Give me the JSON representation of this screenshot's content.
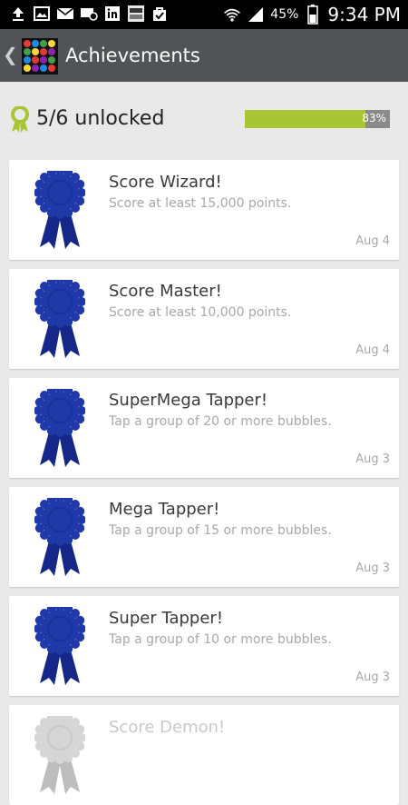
{
  "status_bar": {
    "battery": "45%",
    "time": "9:34 PM",
    "icons": [
      "upload-icon",
      "image-icon",
      "mail-icon",
      "mail-at-icon",
      "linkedin-icon",
      "basic4android-icon",
      "bag-icon"
    ]
  },
  "action_bar": {
    "title": "Achievements"
  },
  "summary": {
    "unlocked": "5/6 unlocked",
    "progress_label": "83%",
    "progress_fraction": 0.83
  },
  "achievements": [
    {
      "title": "Score Wizard!",
      "description": "Score at least 15,000 points.",
      "date": "Aug 4"
    },
    {
      "title": "Score Master!",
      "description": "Score at least 10,000 points.",
      "date": "Aug 4"
    },
    {
      "title": "SuperMega Tapper!",
      "description": "Tap a group of 20 or more bubbles.",
      "date": "Aug 3"
    },
    {
      "title": "Mega Tapper!",
      "description": "Tap a group of 15 or more bubbles.",
      "date": "Aug 3"
    },
    {
      "title": "Super Tapper!",
      "description": "Tap a group of 10 or more bubbles.",
      "date": "Aug 3"
    },
    {
      "title": "Score Demon!",
      "description": "",
      "date": ""
    }
  ],
  "colors": {
    "ribbon_blue": "#1f3aa8",
    "progress_green": "#a8c536",
    "action_bar": "#505456"
  }
}
